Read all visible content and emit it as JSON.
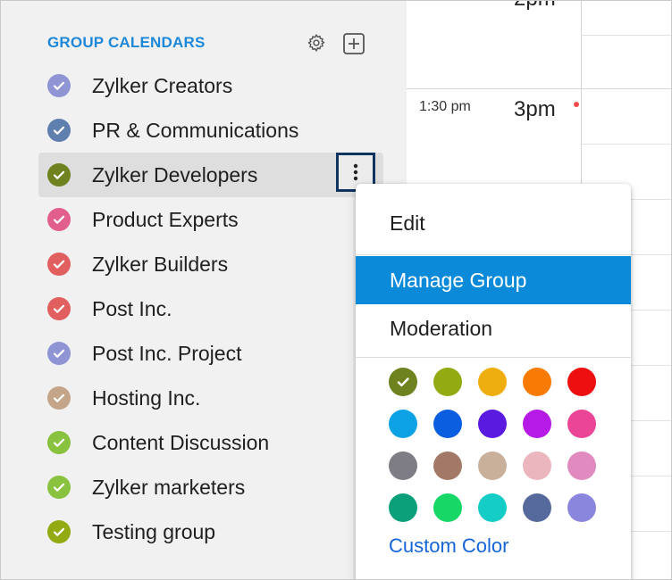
{
  "sidebar": {
    "section_title": "GROUP CALENDARS",
    "settings_icon": "gear-icon",
    "add_icon": "plus-square-icon",
    "calendars": [
      {
        "label": "Zylker Creators",
        "color": "#8f95d4"
      },
      {
        "label": "PR & Communications",
        "color": "#5f7fae"
      },
      {
        "label": "Zylker Developers",
        "color": "#6e8220"
      },
      {
        "label": "Product Experts",
        "color": "#e25f8d"
      },
      {
        "label": "Zylker Builders",
        "color": "#e25f60"
      },
      {
        "label": "Post Inc.",
        "color": "#e25f60"
      },
      {
        "label": "Post Inc. Project",
        "color": "#8f95d4"
      },
      {
        "label": "Hosting Inc.",
        "color": "#c4a58a"
      },
      {
        "label": "Content Discussion",
        "color": "#89c23f"
      },
      {
        "label": "Zylker marketers",
        "color": "#89c23f"
      },
      {
        "label": "Testing group",
        "color": "#93aa12"
      }
    ],
    "active_index": 2
  },
  "grid": {
    "time_small": "1:30 pm",
    "time_big": "3pm",
    "time_prev": "2pm"
  },
  "menu": {
    "items": [
      "Edit",
      "Manage Group",
      "Moderation"
    ],
    "highlighted": "Manage Group",
    "swatch_colors": [
      [
        "#6e8220",
        "#93aa12",
        "#efae0f",
        "#f77b04",
        "#ee1010"
      ],
      [
        "#0da2e6",
        "#0b5ee0",
        "#5a1ae0",
        "#b61ae6",
        "#ea4597"
      ],
      [
        "#7e7c84",
        "#a27966",
        "#c8b09a",
        "#ecb6bf",
        "#e18ac0"
      ],
      [
        "#0ba07a",
        "#17d866",
        "#13cdc6",
        "#55699c",
        "#8b86dd"
      ]
    ],
    "selected_swatch": "#6e8220",
    "custom_color_label": "Custom Color"
  }
}
